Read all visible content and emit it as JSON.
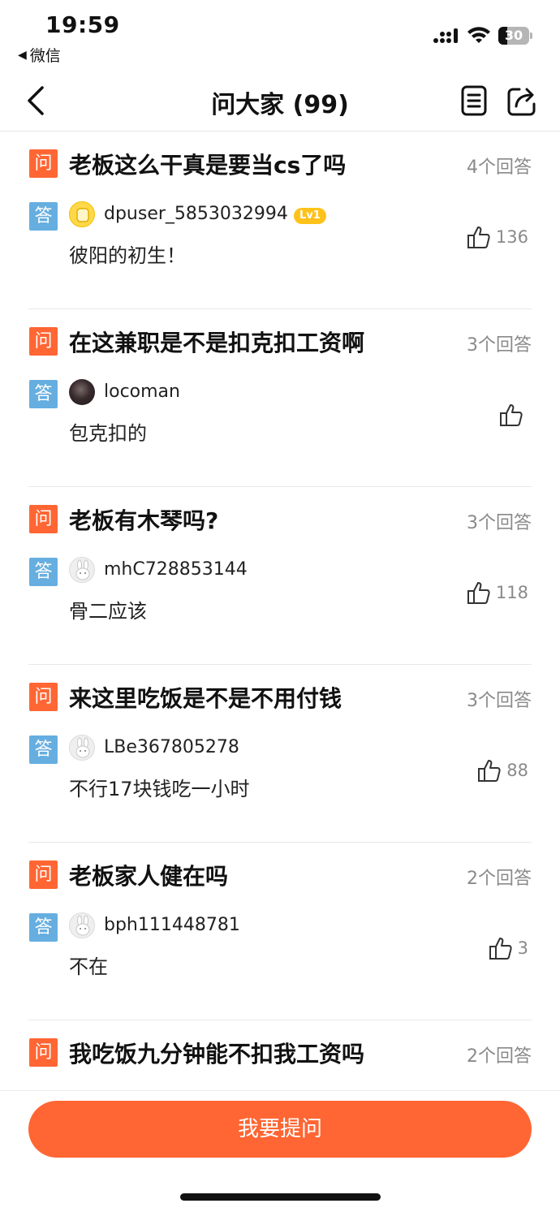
{
  "status_bar": {
    "time": "19:59",
    "back_app": "微信",
    "battery": "30"
  },
  "nav": {
    "title": "问大家 (99)"
  },
  "badges": {
    "question": "问",
    "answer": "答"
  },
  "items": [
    {
      "question": "老板这么干真是要当cs了吗",
      "answer_count": "4个回答",
      "user": "dpuser_5853032994",
      "level": "Lv1",
      "avatar": "yellow-avatar",
      "answer": "彼阳的初生！",
      "likes": "136"
    },
    {
      "question": "在这兼职是不是扣克扣工资啊",
      "answer_count": "3个回答",
      "user": "locoman",
      "avatar": "photo-avatar",
      "answer": "包克扣的",
      "likes": ""
    },
    {
      "question": "老板有木琴吗?",
      "answer_count": "3个回答",
      "user": "mhC728853144",
      "avatar": "bunny-avatar",
      "answer": "骨二应该",
      "likes": "118"
    },
    {
      "question": "来这里吃饭是不是不用付钱",
      "answer_count": "3个回答",
      "user": "LBe367805278",
      "avatar": "bunny-avatar",
      "answer": "不行17块钱吃一小时",
      "likes": "88"
    },
    {
      "question": "老板家人健在吗",
      "answer_count": "2个回答",
      "user": "bph111448781",
      "avatar": "bunny-avatar",
      "answer": "不在",
      "likes": "3"
    },
    {
      "question": "我吃饭九分钟能不扣我工资吗",
      "answer_count": "2个回答"
    }
  ],
  "bottom": {
    "ask_button": "我要提问"
  },
  "colors": {
    "accent": "#ff6633",
    "answer_badge": "#66aee0",
    "level_badge": "#ffc21a"
  }
}
